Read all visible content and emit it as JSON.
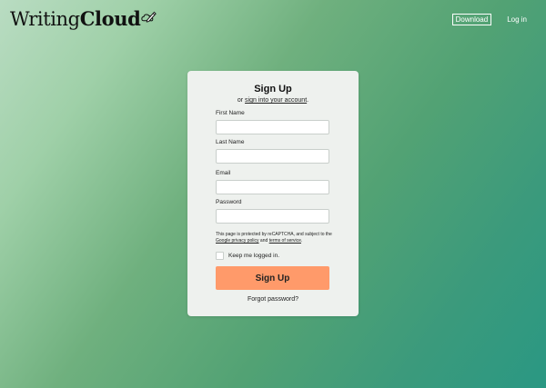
{
  "brand": {
    "name_part1": "Writing",
    "name_part2": "Cloud",
    "icon": "pen-cloud-icon"
  },
  "nav": {
    "download_label": "Download",
    "login_label": "Log in"
  },
  "form": {
    "title": "Sign Up",
    "subtitle_prefix": "or ",
    "subtitle_link": "sign into your account",
    "subtitle_suffix": ".",
    "fields": [
      {
        "label": "First Name",
        "value": "",
        "placeholder": ""
      },
      {
        "label": "Last Name",
        "value": "",
        "placeholder": ""
      },
      {
        "label": "Email",
        "value": "",
        "placeholder": ""
      },
      {
        "label": "Password",
        "value": "",
        "placeholder": ""
      }
    ],
    "recaptcha": {
      "text_1": "This page is protected by reCAPTCHA, and subject to the ",
      "privacy_link": "Google privacy policy",
      "text_2": " and ",
      "terms_link": "terms of service",
      "text_3": "."
    },
    "keep_logged_in_label": "Keep me logged in.",
    "keep_logged_in_checked": false,
    "submit_label": "Sign Up",
    "forgot_label": "Forgot password?"
  },
  "colors": {
    "accent_button": "#ff9a6a",
    "card_bg": "#eef1ee",
    "gradient_start": "#b9dcc2",
    "gradient_end": "#2a9883"
  }
}
